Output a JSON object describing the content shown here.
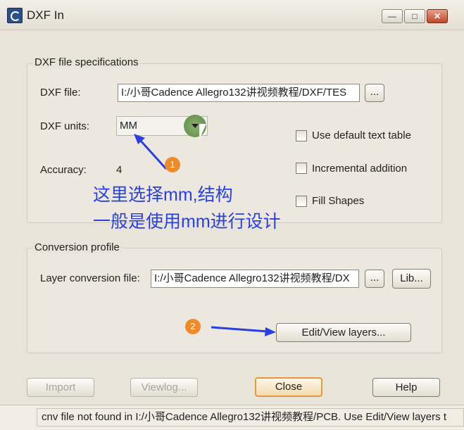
{
  "window": {
    "title": "DXF In"
  },
  "title_buttons": {
    "minimize": "—",
    "maximize": "□",
    "close": "✕"
  },
  "dxf_specs": {
    "group_title": "DXF file specifications",
    "file_label": "DXF file:",
    "file_value": "I:/小哥Cadence Allegro132讲视频教程/DXF/TES",
    "browse_label": "...",
    "units_label": "DXF units:",
    "units_value": "MM",
    "accuracy_label": "Accuracy:",
    "accuracy_value": "4"
  },
  "options": {
    "use_default_text_table": {
      "label": "Use default text table",
      "checked": false
    },
    "incremental_addition": {
      "label": "Incremental addition",
      "checked": false
    },
    "fill_shapes": {
      "label": "Fill Shapes",
      "checked": false
    }
  },
  "conversion": {
    "group_title": "Conversion profile",
    "layer_file_label": "Layer conversion file:",
    "layer_file_value": "I:/小哥Cadence Allegro132讲视频教程/DX",
    "browse_label": "...",
    "lib_label": "Lib...",
    "edit_view_label": "Edit/View layers..."
  },
  "buttons": {
    "import": "Import",
    "viewlog": "Viewlog...",
    "close": "Close",
    "help": "Help"
  },
  "status": {
    "text": "cnv file not found in I:/小哥Cadence Allegro132讲视频教程/PCB. Use Edit/View layers t"
  },
  "annotations": {
    "badge1": "1",
    "badge2": "2",
    "line1": "这里选择mm,结构",
    "line2": "一般是使用mm进行设计",
    "color": "#2a3fe0"
  }
}
